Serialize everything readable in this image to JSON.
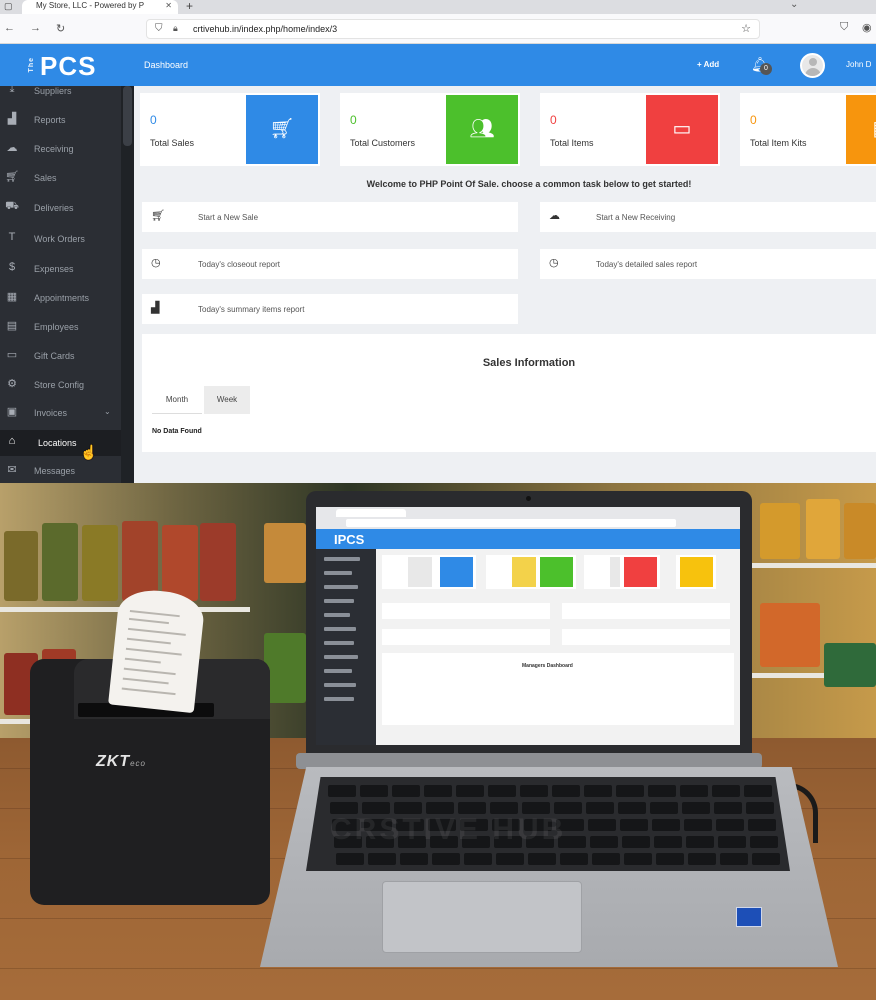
{
  "browser": {
    "tab_title": "My Store, LLC - Powered by P",
    "url": "crtivehub.in/index.php/home/index/3"
  },
  "header": {
    "logo": "PCS",
    "logo_prefix": "The",
    "nav_label": "Dashboard",
    "add_label": "+ Add",
    "notification_count": "0",
    "user_name": "John D"
  },
  "sidebar": {
    "items": [
      {
        "label": "Suppliers",
        "icon": "download-icon"
      },
      {
        "label": "Reports",
        "icon": "bar-chart-icon"
      },
      {
        "label": "Receiving",
        "icon": "cloud-download-icon"
      },
      {
        "label": "Sales",
        "icon": "cart-icon"
      },
      {
        "label": "Deliveries",
        "icon": "truck-icon"
      },
      {
        "label": "Work Orders",
        "icon": "tools-icon"
      },
      {
        "label": "Expenses",
        "icon": "dollar-icon"
      },
      {
        "label": "Appointments",
        "icon": "calendar-icon"
      },
      {
        "label": "Employees",
        "icon": "id-card-icon"
      },
      {
        "label": "Gift Cards",
        "icon": "credit-card-icon"
      },
      {
        "label": "Store Config",
        "icon": "gear-icon"
      },
      {
        "label": "Invoices",
        "icon": "invoice-icon"
      },
      {
        "label": "Locations",
        "icon": "home-icon"
      },
      {
        "label": "Messages",
        "icon": "envelope-icon"
      }
    ],
    "active_item": "Locations"
  },
  "stats": [
    {
      "value": "0",
      "label": "Total Sales",
      "color": "#2f8ae6",
      "icon": "cart-icon"
    },
    {
      "value": "0",
      "label": "Total Customers",
      "color": "#4cc02c",
      "icon": "customers-icon"
    },
    {
      "value": "0",
      "label": "Total Items",
      "color": "#f04040",
      "icon": "inbox-icon"
    },
    {
      "value": "0",
      "label": "Total Item Kits",
      "color": "#f7950d",
      "icon": "kit-icon"
    }
  ],
  "welcome_text": "Welcome to PHP Point Of Sale. choose a common task below to get started!",
  "tasks": [
    {
      "label": "Start a New Sale",
      "icon": "cart-icon"
    },
    {
      "label": "Start a New Receiving",
      "icon": "cloud-download-icon"
    },
    {
      "label": "Today's closeout report",
      "icon": "clock-icon"
    },
    {
      "label": "Today's detailed sales report",
      "icon": "clock-icon"
    },
    {
      "label": "Today's summary items report",
      "icon": "bar-chart-icon"
    }
  ],
  "sales_info": {
    "title": "Sales Information",
    "tabs": [
      "Month",
      "Week"
    ],
    "selected_tab": "Month",
    "empty_text": "No Data Found"
  },
  "photo": {
    "printer_brand": "ZKT",
    "printer_model": "eco",
    "laptop_app_logo": "IPCS",
    "watermark": "CRSTIVE HUB",
    "screen_welcome": "Managers Dashboard"
  }
}
